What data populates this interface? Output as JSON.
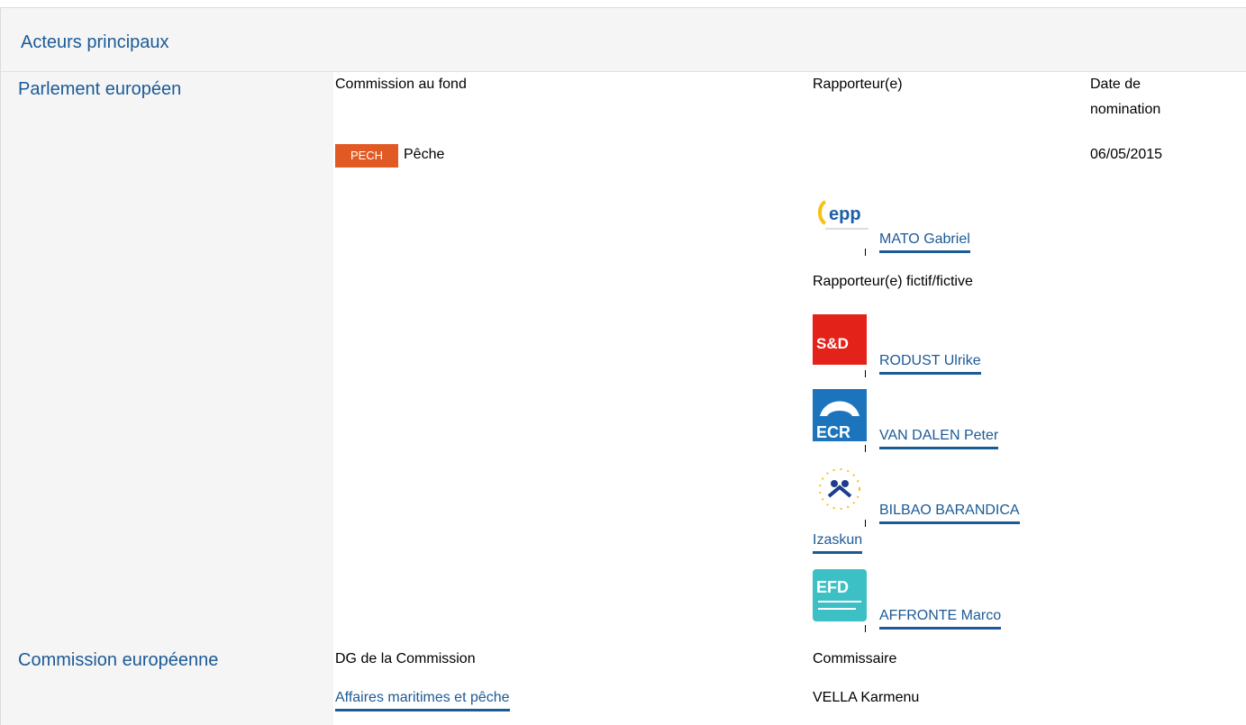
{
  "header": {
    "title": "Acteurs principaux"
  },
  "parliament": {
    "label": "Parlement européen",
    "col_committee": "Commission au fond",
    "col_rapporteur": "Rapporteur(e)",
    "col_date": "Date de nomination",
    "committee_badge": "PECH",
    "committee_name": "Pêche",
    "date": "06/05/2015",
    "rapporteur": {
      "name": "MATO Gabriel",
      "group_logo": "epp-logo"
    },
    "shadow_label": "Rapporteur(e) fictif/fictive",
    "shadows": [
      {
        "name": "RODUST Ulrike",
        "group_logo": "sd-logo",
        "logo_text": "S&D"
      },
      {
        "name": "VAN DALEN Peter",
        "group_logo": "ecr-logo",
        "logo_text": "ECR"
      },
      {
        "name_line1": "BILBAO BARANDICA",
        "name_line2": "Izaskun",
        "group_logo": "alde-logo"
      },
      {
        "name": "AFFRONTE Marco",
        "group_logo": "efdd-logo",
        "logo_text": "EFD"
      }
    ],
    "epp_logo_text": "epp"
  },
  "commission": {
    "label": "Commission européenne",
    "col_dg": "DG de la Commission",
    "col_commissioner": "Commissaire",
    "dg_name": "Affaires maritimes et pêche",
    "commissioner": "VELLA Karmenu"
  },
  "colors": {
    "accent": "#1c5a96",
    "badge": "#e15a24",
    "sd": "#e3221a",
    "ecr": "#1c75bc",
    "efdd": "#3cbfc5"
  }
}
